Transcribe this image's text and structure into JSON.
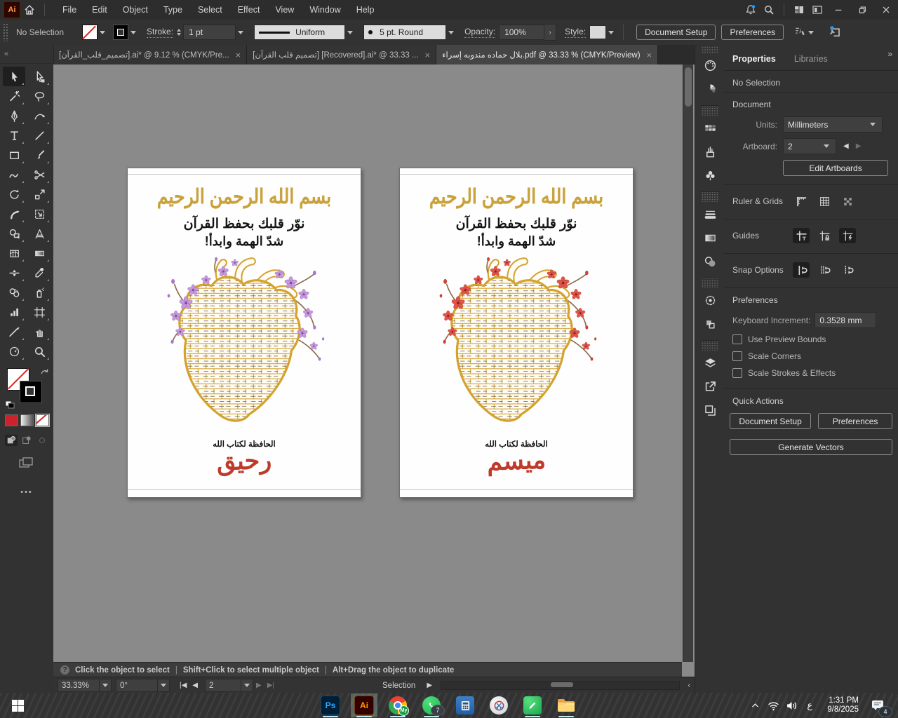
{
  "titlebar": {
    "menus": [
      "File",
      "Edit",
      "Object",
      "Type",
      "Select",
      "Effect",
      "View",
      "Window",
      "Help"
    ]
  },
  "controlbar": {
    "selection_status": "No Selection",
    "stroke_label": "Stroke:",
    "stroke_weight": "1 pt",
    "width_profile": "Uniform",
    "brush_definition": "5 pt. Round",
    "opacity_label": "Opacity:",
    "opacity_value": "100%",
    "style_label": "Style:",
    "document_setup_label": "Document Setup",
    "preferences_label": "Preferences"
  },
  "tabs": [
    {
      "label": "[تصميم_قلب_القرآن].ai* @ 9.12 % (CMYK/Pre..."
    },
    {
      "label": "[تصميم قلب القرآن] [Recovered].ai* @ 33.33 ..."
    },
    {
      "label": "بلال حماده مندوبه إسراء.pdf @ 33.33 % (CMYK/Preview)"
    }
  ],
  "artboards": [
    {
      "bismillah": "بسم الله الرحمن الرحيم",
      "headline_line1": "نوّر قلبك بحفظ القرآن",
      "headline_line2": "شدّ الهمة وابدأ!",
      "footer": "الحافظة لكتاب الله",
      "name": "رحيق"
    },
    {
      "bismillah": "بسم الله الرحمن الرحيم",
      "headline_line1": "نوّر قلبك بحفظ القرآن",
      "headline_line2": "شدّ الهمة وابدأ!",
      "footer": "الحافظة لكتاب الله",
      "name": "ميسم"
    }
  ],
  "properties": {
    "tab_properties": "Properties",
    "tab_libraries": "Libraries",
    "no_selection": "No Selection",
    "document_header": "Document",
    "units_label": "Units:",
    "units_value": "Millimeters",
    "artboard_label": "Artboard:",
    "artboard_value": "2",
    "edit_artboards": "Edit Artboards",
    "ruler_grids_label": "Ruler & Grids",
    "guides_label": "Guides",
    "snap_options_label": "Snap Options",
    "preferences_header": "Preferences",
    "keyboard_increment_label": "Keyboard Increment:",
    "keyboard_increment_value": "0.3528 mm",
    "checkbox_preview_bounds": "Use Preview Bounds",
    "checkbox_scale_corners": "Scale Corners",
    "checkbox_scale_strokes": "Scale Strokes & Effects",
    "quick_actions_header": "Quick Actions",
    "qa_document_setup": "Document Setup",
    "qa_preferences": "Preferences",
    "qa_generate_vectors": "Generate Vectors"
  },
  "hintbar": {
    "hint1": "Click the object to select",
    "hint2": "Shift+Click to select multiple object",
    "hint3": "Alt+Drag the object to duplicate"
  },
  "statusbar": {
    "zoom": "33.33%",
    "rotation": "0°",
    "artboard_number": "2",
    "tool_label": "Selection"
  },
  "taskbar": {
    "whatsapp_badge": "7",
    "time": "1:31 PM",
    "date": "9/8/2025",
    "language": "ع",
    "notification_count": "4"
  },
  "icons": {
    "close": "×",
    "collapse_left": "«",
    "collapse_right": "»",
    "help": "?",
    "more": "•••",
    "swap": "⤸",
    "prev": "◀",
    "next": "▶",
    "first": "|◀",
    "last": "▶|",
    "flyout": "▶",
    "scroll_left": "‹"
  },
  "colors": {
    "gold": "#d4a22f",
    "name_red": "#bf3a2b",
    "accent_blue": "#2e9bf0",
    "taskbar_green": "#0b6e46"
  }
}
